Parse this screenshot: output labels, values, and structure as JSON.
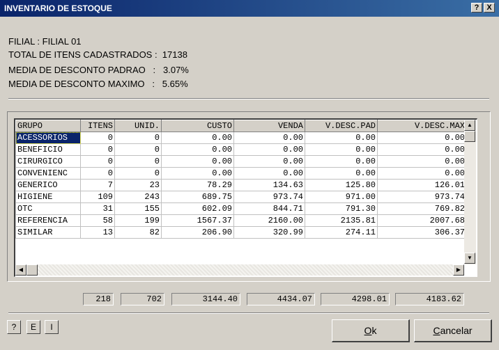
{
  "window": {
    "title": "INVENTARIO DE ESTOQUE",
    "help_glyph": "?",
    "close_glyph": "X"
  },
  "info": {
    "filial": "FILIAL : FILIAL 01",
    "total_itens": "TOTAL DE ITENS CADASTRADOS :  17138",
    "media_padrao": "MEDIA DE DESCONTO PADRAO   :   3.07%",
    "media_maximo": "MEDIA DE DESCONTO MAXIMO   :   5.65%"
  },
  "grid": {
    "columns": [
      "GRUPO",
      "ITENS",
      "UNID.",
      "CUSTO",
      "VENDA",
      "V.DESC.PAD",
      "V.DESC.MAX"
    ],
    "rows": [
      [
        "ACESSORIOS",
        "0",
        "0",
        "0.00",
        "0.00",
        "0.00",
        "0.00"
      ],
      [
        "BENEFICIO",
        "0",
        "0",
        "0.00",
        "0.00",
        "0.00",
        "0.00"
      ],
      [
        "CIRURGICO",
        "0",
        "0",
        "0.00",
        "0.00",
        "0.00",
        "0.00"
      ],
      [
        "CONVENIENC",
        "0",
        "0",
        "0.00",
        "0.00",
        "0.00",
        "0.00"
      ],
      [
        "GENERICO",
        "7",
        "23",
        "78.29",
        "134.63",
        "125.80",
        "126.01"
      ],
      [
        "HIGIENE",
        "109",
        "243",
        "689.75",
        "973.74",
        "971.00",
        "973.74"
      ],
      [
        "OTC",
        "31",
        "155",
        "602.09",
        "844.71",
        "791.30",
        "769.82"
      ],
      [
        "REFERENCIA",
        "58",
        "199",
        "1567.37",
        "2160.00",
        "2135.81",
        "2007.68"
      ],
      [
        "SIMILAR",
        "13",
        "82",
        "206.90",
        "320.99",
        "274.11",
        "306.37"
      ]
    ]
  },
  "totals": {
    "itens": "218",
    "unid": "702",
    "custo": "3144.40",
    "venda": "4434.07",
    "desc_pad": "4298.01",
    "desc_max": "4183.62"
  },
  "buttons": {
    "help": "?",
    "e": "E",
    "i": "I",
    "ok_underlined": "O",
    "ok_rest": "k",
    "cancel_underlined": "C",
    "cancel_rest": "ancelar"
  },
  "scroll_glyphs": {
    "up": "▲",
    "down": "▼",
    "left": "◀",
    "right": "▶"
  }
}
